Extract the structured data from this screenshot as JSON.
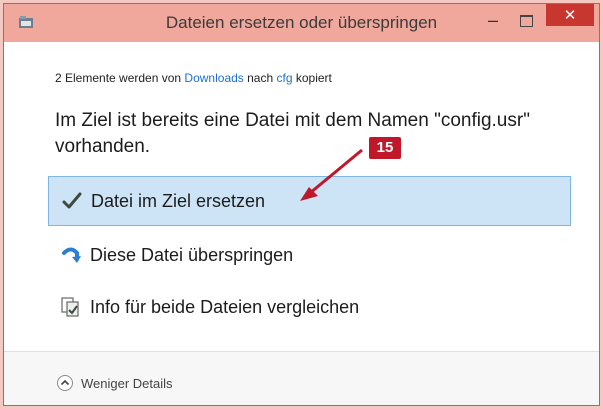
{
  "window": {
    "title": "Dateien ersetzen oder überspringen",
    "minimize_glyph": "–",
    "close_glyph": "✕"
  },
  "info": {
    "prefix": "2 Elemente werden von ",
    "source": "Downloads",
    "middle": " nach ",
    "target": "cfg",
    "suffix": " kopiert"
  },
  "question": "Im Ziel ist bereits eine Datei mit dem Namen \"config.usr\" vorhanden.",
  "annotation": {
    "badge": "15",
    "color": "#c01828"
  },
  "options": [
    {
      "label": "Datei im Ziel ersetzen",
      "icon": "checkmark-icon",
      "selected": true
    },
    {
      "label": "Diese Datei überspringen",
      "icon": "skip-arrow-icon",
      "selected": false
    },
    {
      "label": "Info für beide Dateien vergleichen",
      "icon": "compare-files-icon",
      "selected": false
    }
  ],
  "footer": {
    "details_label": "Weniger Details",
    "icon": "chevron-up-icon"
  },
  "colors": {
    "titlebar": "#f0a79c",
    "close": "#c7372f",
    "selected": "#cde4f7",
    "link": "#1f6fd1"
  }
}
